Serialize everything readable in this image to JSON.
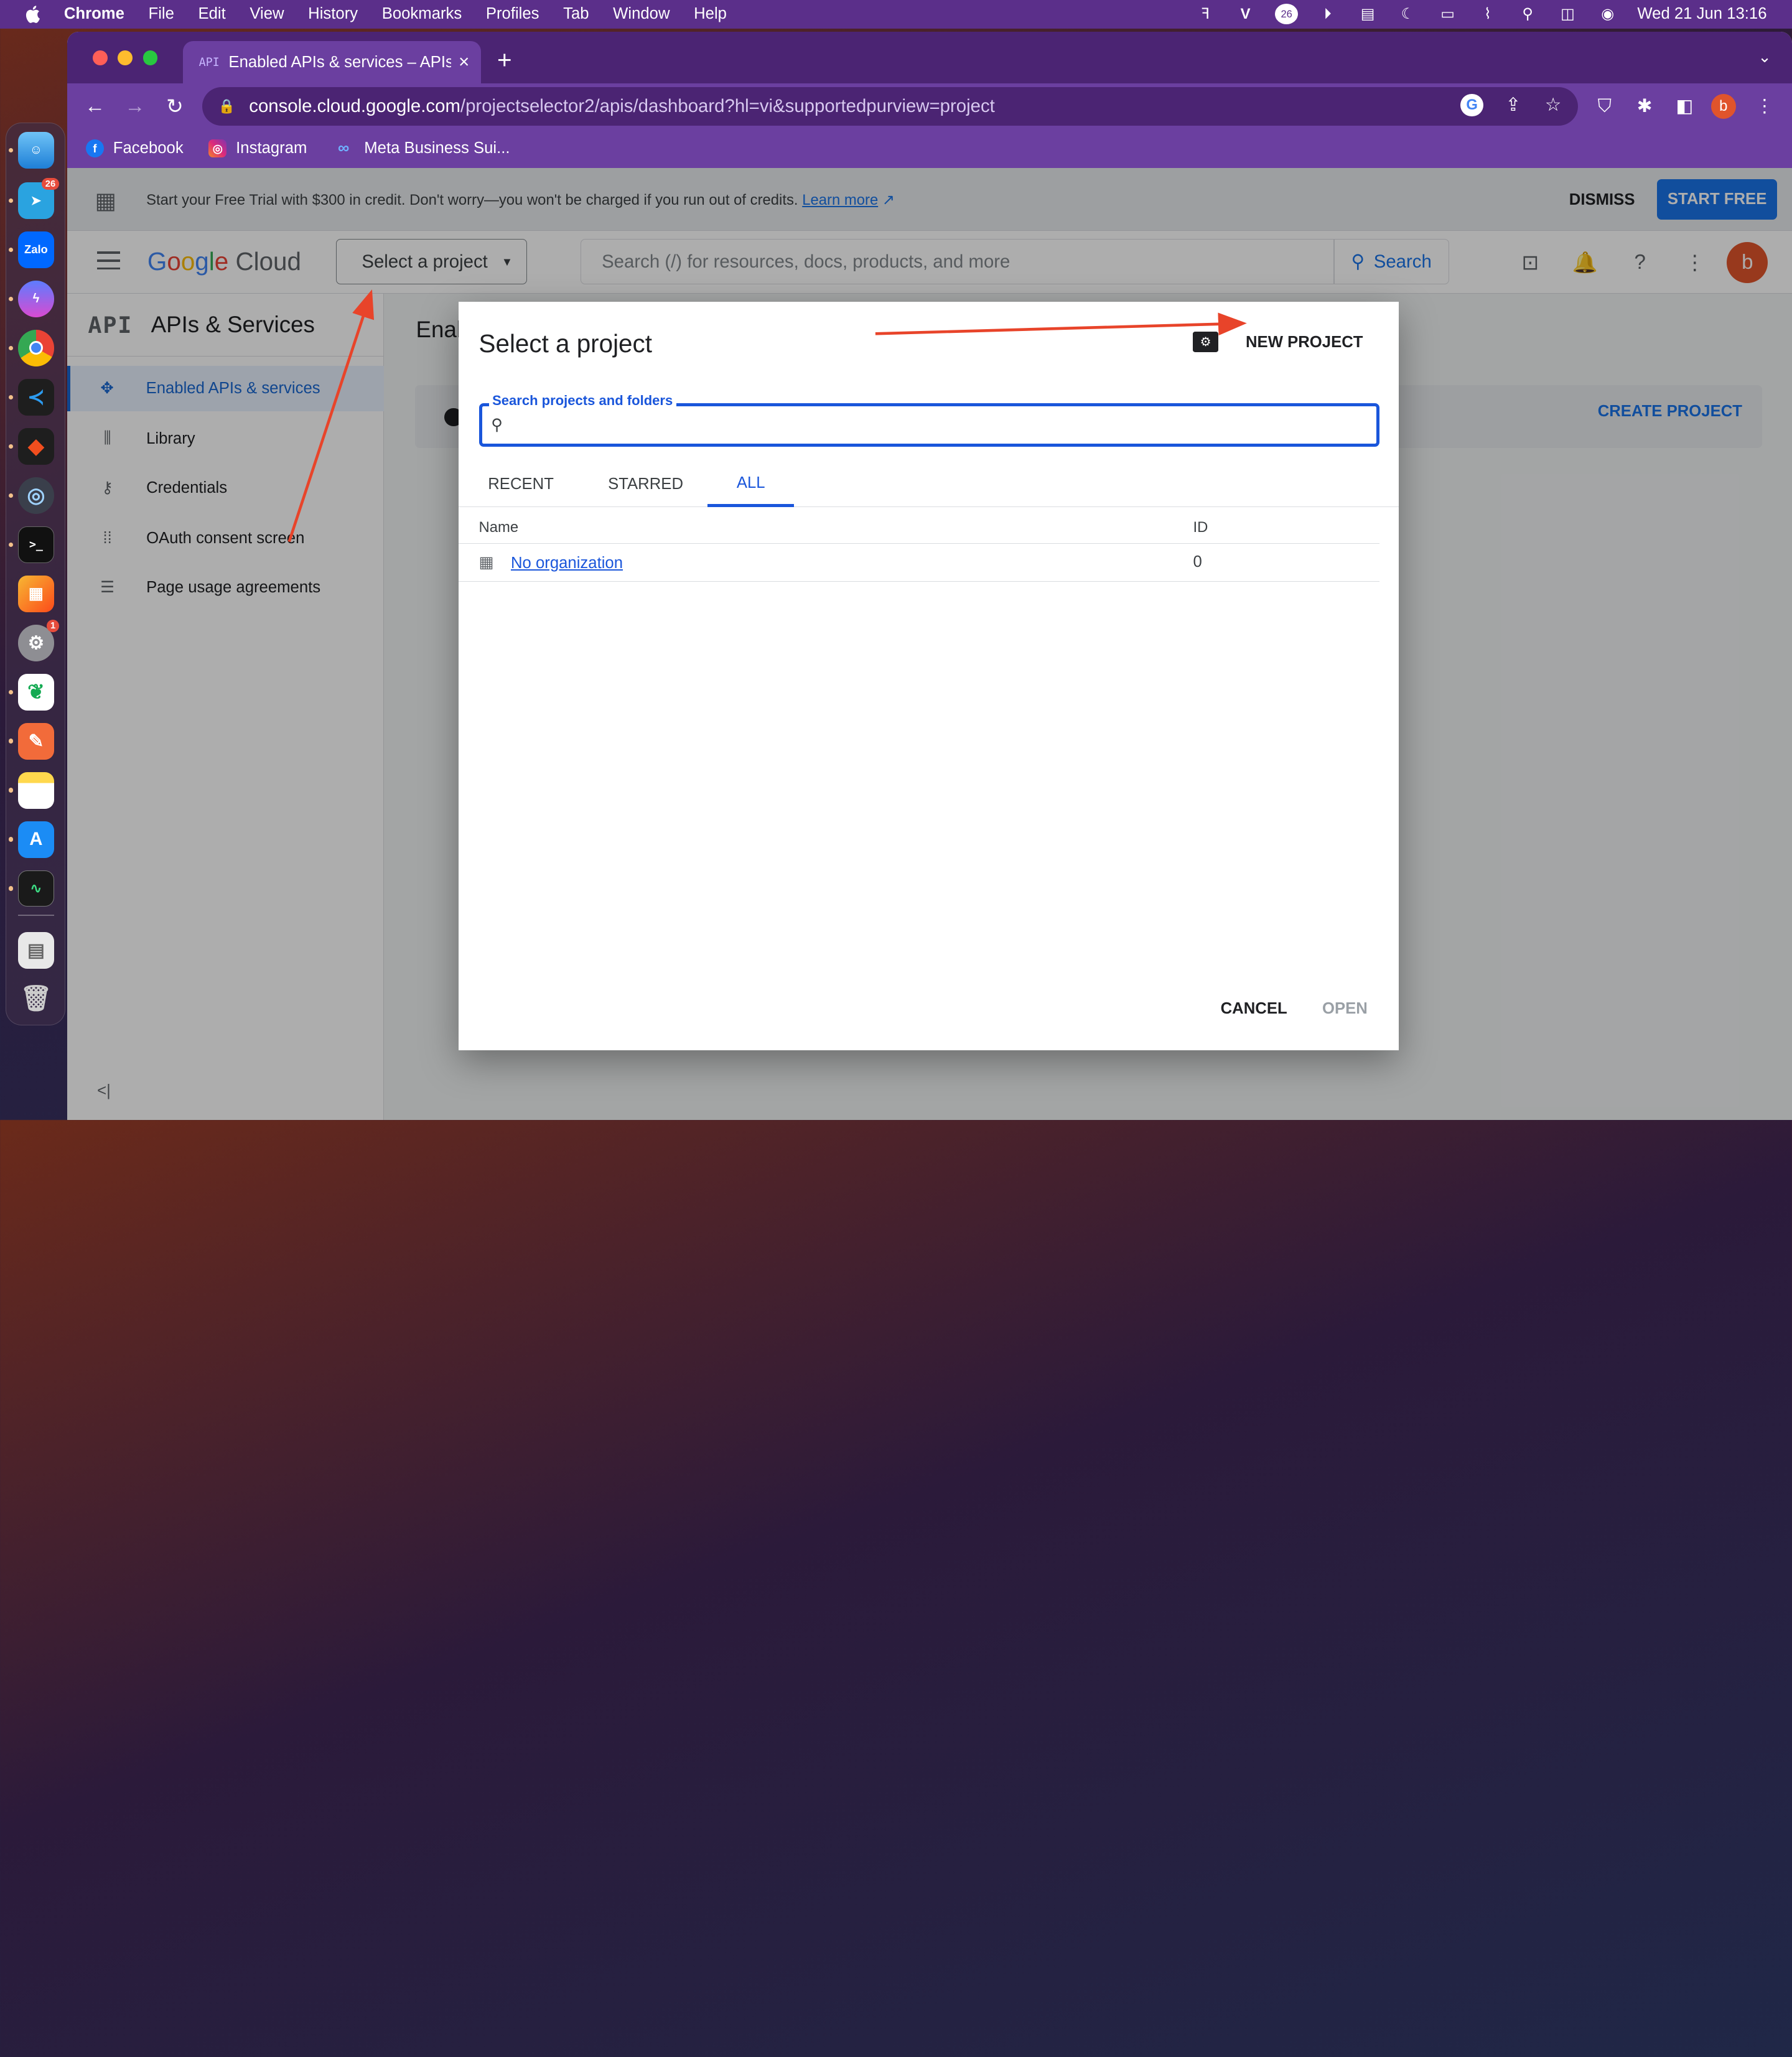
{
  "menubar": {
    "app_name": "Chrome",
    "menus": [
      "File",
      "Edit",
      "View",
      "History",
      "Bookmarks",
      "Profiles",
      "Tab",
      "Window",
      "Help"
    ],
    "clock": "Wed 21 Jun  13:16",
    "status_badge": "26"
  },
  "dock": {
    "telegram_badge": "26",
    "zalo_label": "Zalo",
    "settings_badge": "1"
  },
  "browser": {
    "tab_favicon": "API",
    "tab_title": "Enabled APIs & services – APIs",
    "new_tab": "+",
    "url_host": "console.cloud.google.com",
    "url_path": "/projectselector2/apis/dashboard?hl=vi&supportedpurview=project",
    "profile_initial": "b",
    "bookmarks": [
      "Facebook",
      "Instagram",
      "Meta Business Sui..."
    ]
  },
  "banner": {
    "text": "Start your Free Trial with $300 in credit. Don't worry—you won't be charged if you run out of credits.",
    "learn_more": "Learn more",
    "dismiss": "DISMISS",
    "start_free": "START FREE"
  },
  "header": {
    "logo_google": "Google",
    "logo_cloud": "Cloud",
    "project_selector": "Select a project",
    "search_placeholder": "Search (/) for resources, docs, products, and more",
    "search_button": "Search",
    "avatar_initial": "b"
  },
  "sidenav": {
    "api_logo": "API",
    "title": "APIs & Services",
    "items": [
      {
        "label": "Enabled APIs & services"
      },
      {
        "label": "Library"
      },
      {
        "label": "Credentials"
      },
      {
        "label": "OAuth consent screen"
      },
      {
        "label": "Page usage agreements"
      }
    ],
    "collapse": "<|"
  },
  "main": {
    "title": "Enab",
    "create_project": "CREATE PROJECT"
  },
  "dialog": {
    "title": "Select a project",
    "new_project": "NEW PROJECT",
    "search_label": "Search projects and folders",
    "tabs": [
      "RECENT",
      "STARRED",
      "ALL"
    ],
    "active_tab": "ALL",
    "columns": {
      "name": "Name",
      "id": "ID"
    },
    "rows": [
      {
        "name": "No organization",
        "id": "0"
      }
    ],
    "cancel": "CANCEL",
    "open": "OPEN"
  },
  "colors": {
    "accent": "#1a56db",
    "browser_frame": "#6b3fa0",
    "annotation_arrow": "#e8442a"
  }
}
